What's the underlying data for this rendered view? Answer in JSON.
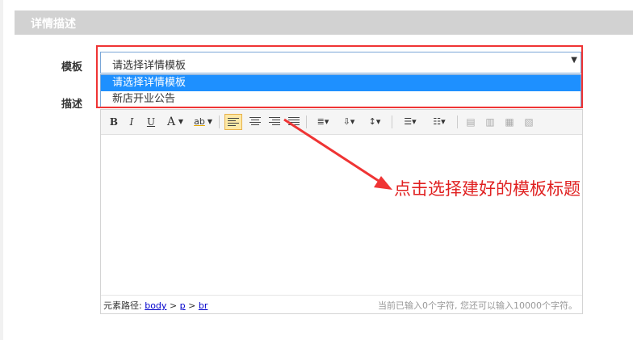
{
  "section": {
    "title": "详情描述"
  },
  "form": {
    "template_label": "模板",
    "template_value": "请选择详情模板",
    "template_options": [
      "请选择详情模板",
      "新店开业公告"
    ],
    "description_label": "描述"
  },
  "toolbar": {
    "bold": "B",
    "italic": "I",
    "underline": "U",
    "fontcolor": "A",
    "highlight": "ab"
  },
  "status": {
    "path_label": "元素路径:",
    "path": [
      "body",
      "p",
      "br"
    ],
    "separator": ">",
    "count_text": "当前已输入0个字符, 您还可以输入10000个字符。"
  },
  "annotation": {
    "text": "点击选择建好的模板标题",
    "color": "#e02020"
  }
}
